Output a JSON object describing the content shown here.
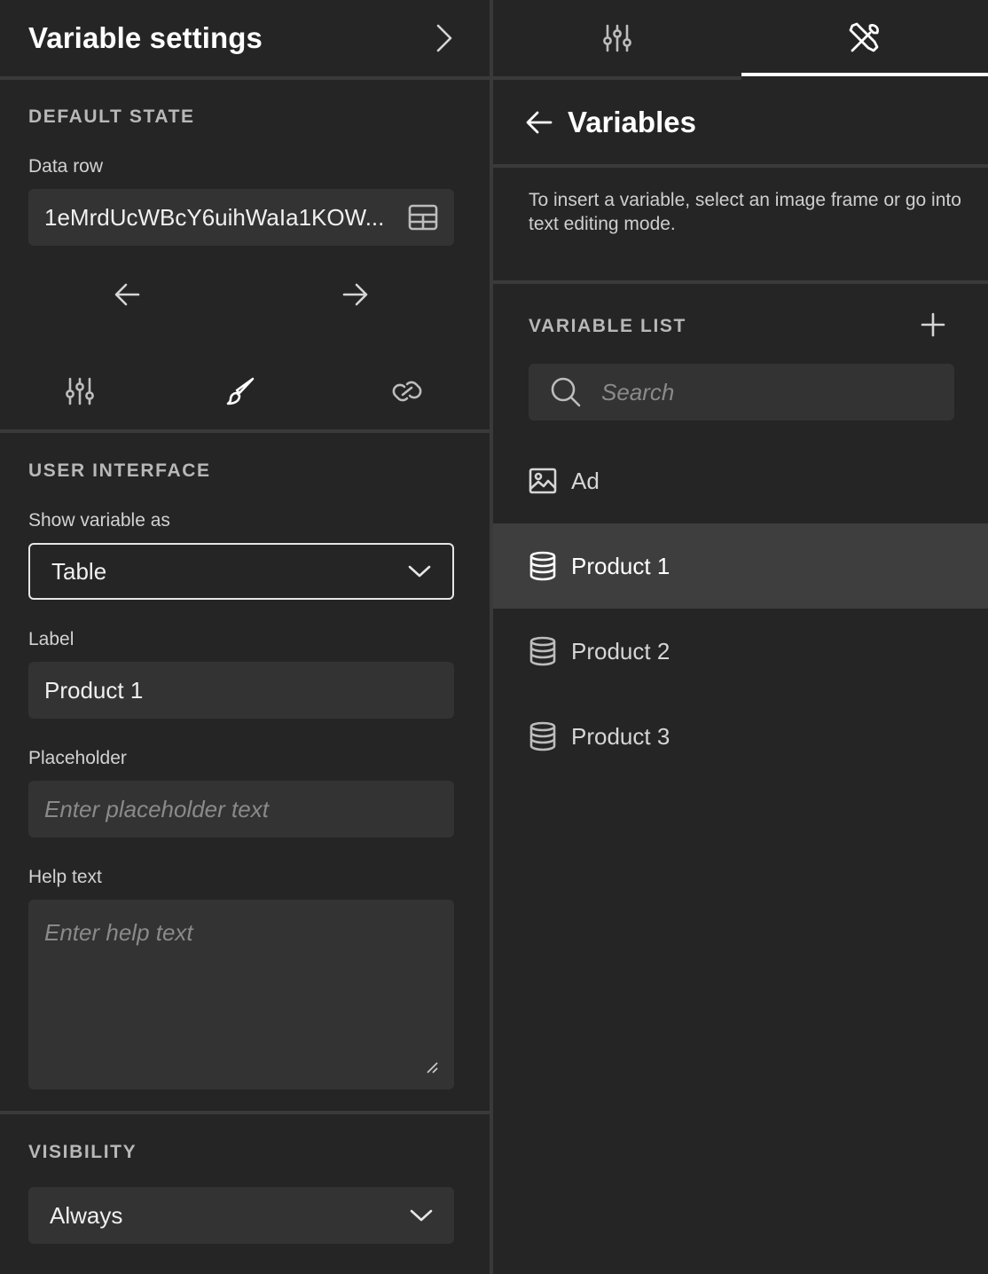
{
  "left_panel": {
    "title": "Variable settings",
    "default_state": {
      "section_title": "DEFAULT STATE",
      "data_row_label": "Data row",
      "data_row_value": "1eMrdUcWBcY6uihWaIa1KOW..."
    },
    "tabs": [
      {
        "icon": "sliders-icon",
        "active": false
      },
      {
        "icon": "paintbrush-icon",
        "active": true
      },
      {
        "icon": "link-icon",
        "active": false
      }
    ],
    "user_interface": {
      "section_title": "USER INTERFACE",
      "show_as_label": "Show variable as",
      "show_as_value": "Table",
      "label_label": "Label",
      "label_value": "Product 1",
      "placeholder_label": "Placeholder",
      "placeholder_placeholder": "Enter placeholder text",
      "help_label": "Help text",
      "help_placeholder": "Enter help text"
    },
    "visibility": {
      "section_title": "VISIBILITY",
      "value": "Always"
    }
  },
  "right_panel": {
    "tabs": [
      {
        "icon": "sliders-icon",
        "active": false
      },
      {
        "icon": "tools-icon",
        "active": true
      }
    ],
    "title": "Variables",
    "info": "To insert a variable, select an image frame or go into text editing mode.",
    "list_title": "VARIABLE LIST",
    "search_placeholder": "Search",
    "variables": [
      {
        "name": "Ad",
        "icon": "image-icon",
        "selected": false
      },
      {
        "name": "Product 1",
        "icon": "database-icon",
        "selected": true
      },
      {
        "name": "Product 2",
        "icon": "database-icon",
        "selected": false
      },
      {
        "name": "Product 3",
        "icon": "database-icon",
        "selected": false
      }
    ]
  },
  "colors": {
    "background": "#252525",
    "field": "#333333",
    "selected_row": "#3e3e3e",
    "divider": "#3a3a3a",
    "accent": "#ffffff"
  }
}
